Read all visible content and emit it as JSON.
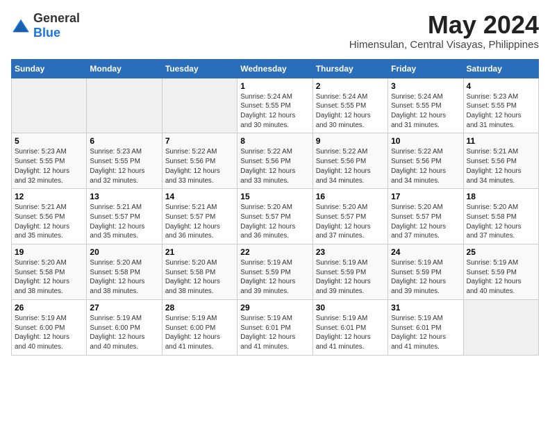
{
  "header": {
    "logo_general": "General",
    "logo_blue": "Blue",
    "title": "May 2024",
    "subtitle": "Himensulan, Central Visayas, Philippines"
  },
  "weekdays": [
    "Sunday",
    "Monday",
    "Tuesday",
    "Wednesday",
    "Thursday",
    "Friday",
    "Saturday"
  ],
  "weeks": [
    [
      {
        "day": "",
        "info": ""
      },
      {
        "day": "",
        "info": ""
      },
      {
        "day": "",
        "info": ""
      },
      {
        "day": "1",
        "info": "Sunrise: 5:24 AM\nSunset: 5:55 PM\nDaylight: 12 hours\nand 30 minutes."
      },
      {
        "day": "2",
        "info": "Sunrise: 5:24 AM\nSunset: 5:55 PM\nDaylight: 12 hours\nand 30 minutes."
      },
      {
        "day": "3",
        "info": "Sunrise: 5:24 AM\nSunset: 5:55 PM\nDaylight: 12 hours\nand 31 minutes."
      },
      {
        "day": "4",
        "info": "Sunrise: 5:23 AM\nSunset: 5:55 PM\nDaylight: 12 hours\nand 31 minutes."
      }
    ],
    [
      {
        "day": "5",
        "info": "Sunrise: 5:23 AM\nSunset: 5:55 PM\nDaylight: 12 hours\nand 32 minutes."
      },
      {
        "day": "6",
        "info": "Sunrise: 5:23 AM\nSunset: 5:55 PM\nDaylight: 12 hours\nand 32 minutes."
      },
      {
        "day": "7",
        "info": "Sunrise: 5:22 AM\nSunset: 5:56 PM\nDaylight: 12 hours\nand 33 minutes."
      },
      {
        "day": "8",
        "info": "Sunrise: 5:22 AM\nSunset: 5:56 PM\nDaylight: 12 hours\nand 33 minutes."
      },
      {
        "day": "9",
        "info": "Sunrise: 5:22 AM\nSunset: 5:56 PM\nDaylight: 12 hours\nand 34 minutes."
      },
      {
        "day": "10",
        "info": "Sunrise: 5:22 AM\nSunset: 5:56 PM\nDaylight: 12 hours\nand 34 minutes."
      },
      {
        "day": "11",
        "info": "Sunrise: 5:21 AM\nSunset: 5:56 PM\nDaylight: 12 hours\nand 34 minutes."
      }
    ],
    [
      {
        "day": "12",
        "info": "Sunrise: 5:21 AM\nSunset: 5:56 PM\nDaylight: 12 hours\nand 35 minutes."
      },
      {
        "day": "13",
        "info": "Sunrise: 5:21 AM\nSunset: 5:57 PM\nDaylight: 12 hours\nand 35 minutes."
      },
      {
        "day": "14",
        "info": "Sunrise: 5:21 AM\nSunset: 5:57 PM\nDaylight: 12 hours\nand 36 minutes."
      },
      {
        "day": "15",
        "info": "Sunrise: 5:20 AM\nSunset: 5:57 PM\nDaylight: 12 hours\nand 36 minutes."
      },
      {
        "day": "16",
        "info": "Sunrise: 5:20 AM\nSunset: 5:57 PM\nDaylight: 12 hours\nand 37 minutes."
      },
      {
        "day": "17",
        "info": "Sunrise: 5:20 AM\nSunset: 5:57 PM\nDaylight: 12 hours\nand 37 minutes."
      },
      {
        "day": "18",
        "info": "Sunrise: 5:20 AM\nSunset: 5:58 PM\nDaylight: 12 hours\nand 37 minutes."
      }
    ],
    [
      {
        "day": "19",
        "info": "Sunrise: 5:20 AM\nSunset: 5:58 PM\nDaylight: 12 hours\nand 38 minutes."
      },
      {
        "day": "20",
        "info": "Sunrise: 5:20 AM\nSunset: 5:58 PM\nDaylight: 12 hours\nand 38 minutes."
      },
      {
        "day": "21",
        "info": "Sunrise: 5:20 AM\nSunset: 5:58 PM\nDaylight: 12 hours\nand 38 minutes."
      },
      {
        "day": "22",
        "info": "Sunrise: 5:19 AM\nSunset: 5:59 PM\nDaylight: 12 hours\nand 39 minutes."
      },
      {
        "day": "23",
        "info": "Sunrise: 5:19 AM\nSunset: 5:59 PM\nDaylight: 12 hours\nand 39 minutes."
      },
      {
        "day": "24",
        "info": "Sunrise: 5:19 AM\nSunset: 5:59 PM\nDaylight: 12 hours\nand 39 minutes."
      },
      {
        "day": "25",
        "info": "Sunrise: 5:19 AM\nSunset: 5:59 PM\nDaylight: 12 hours\nand 40 minutes."
      }
    ],
    [
      {
        "day": "26",
        "info": "Sunrise: 5:19 AM\nSunset: 6:00 PM\nDaylight: 12 hours\nand 40 minutes."
      },
      {
        "day": "27",
        "info": "Sunrise: 5:19 AM\nSunset: 6:00 PM\nDaylight: 12 hours\nand 40 minutes."
      },
      {
        "day": "28",
        "info": "Sunrise: 5:19 AM\nSunset: 6:00 PM\nDaylight: 12 hours\nand 41 minutes."
      },
      {
        "day": "29",
        "info": "Sunrise: 5:19 AM\nSunset: 6:01 PM\nDaylight: 12 hours\nand 41 minutes."
      },
      {
        "day": "30",
        "info": "Sunrise: 5:19 AM\nSunset: 6:01 PM\nDaylight: 12 hours\nand 41 minutes."
      },
      {
        "day": "31",
        "info": "Sunrise: 5:19 AM\nSunset: 6:01 PM\nDaylight: 12 hours\nand 41 minutes."
      },
      {
        "day": "",
        "info": ""
      }
    ]
  ]
}
